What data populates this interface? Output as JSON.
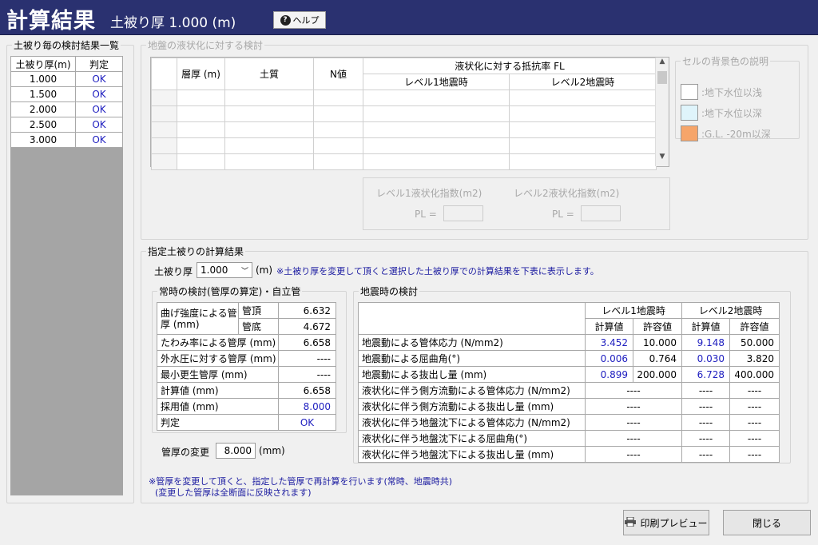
{
  "header": {
    "title": "計算結果",
    "subtitle": "土被り厚 1.000 (m)",
    "help_label": "ヘルプ"
  },
  "left_panel": {
    "legend": "土被り毎の検討結果一覧",
    "columns": [
      "土被り厚(m)",
      "判定"
    ],
    "rows": [
      {
        "depth": "1.000",
        "result": "OK"
      },
      {
        "depth": "1.500",
        "result": "OK"
      },
      {
        "depth": "2.000",
        "result": "OK"
      },
      {
        "depth": "2.500",
        "result": "OK"
      },
      {
        "depth": "3.000",
        "result": "OK"
      }
    ]
  },
  "liquefaction": {
    "legend": "地盤の液状化に対する検討",
    "col_thickness": "層厚 (m)",
    "col_soil": "土質",
    "col_n": "N値",
    "col_fl": "液状化に対する抵抗率 FL",
    "col_l1": "レベル1地震時",
    "col_l2": "レベル2地震時",
    "pl_l1_title": "レベル1液状化指数(m2)",
    "pl_l2_title": "レベル2液状化指数(m2)",
    "pl_label": "PL ="
  },
  "cell_legend": {
    "title": "セルの背景色の説明",
    "items": [
      {
        "label": ":地下水位以浅",
        "color": "#ffffff"
      },
      {
        "label": ":地下水位以深",
        "color": "#dff4fb"
      },
      {
        "label": ":G.L. -20m以深",
        "color": "#f6a56a"
      }
    ]
  },
  "spec": {
    "legend": "指定土被りの計算結果",
    "depth_label": "土被り厚",
    "depth_value": "1.000",
    "depth_unit": "(m)",
    "note": "※土被り厚を変更して頂くと選択した土被り厚での計算結果を下表に表示します。"
  },
  "normal": {
    "legend": "常時の検討(管厚の算定)・自立管",
    "bending_label": "曲げ強度による管厚 (mm)",
    "top_label": "管頂",
    "top_value": "6.632",
    "bottom_label": "管底",
    "bottom_value": "4.672",
    "rows": [
      {
        "label": "たわみ率による管厚 (mm)",
        "value": "6.658",
        "blue": false
      },
      {
        "label": "外水圧に対する管厚 (mm)",
        "value": "----",
        "blue": false
      },
      {
        "label": "最小更生管厚 (mm)",
        "value": "----",
        "blue": false
      },
      {
        "label": "計算値 (mm)",
        "value": "6.658",
        "blue": false
      },
      {
        "label": "採用値 (mm)",
        "value": "8.000",
        "blue": true
      },
      {
        "label": "判定",
        "value": "OK",
        "blue": true
      }
    ],
    "change_label": "管厚の変更",
    "change_value": "8.000",
    "change_unit": "(mm)"
  },
  "seismic": {
    "legend": "地震時の検討",
    "level1": "レベル1地震時",
    "level2": "レベル2地震時",
    "calc": "計算値",
    "allow": "許容値",
    "rows": [
      {
        "label": "地震動による管体応力 (N/mm2)",
        "c1": "3.452",
        "a1": "10.000",
        "c2": "9.148",
        "a2": "50.000"
      },
      {
        "label": "地震動による屈曲角(°)",
        "c1": "0.006",
        "a1": "0.764",
        "c2": "0.030",
        "a2": "3.820"
      },
      {
        "label": "地震動による抜出し量 (mm)",
        "c1": "0.899",
        "a1": "200.000",
        "c2": "6.728",
        "a2": "400.000"
      }
    ],
    "merged_rows": [
      {
        "label": "液状化に伴う側方流動による管体応力 (N/mm2)",
        "v1": "----",
        "c2": "----",
        "a2": "----"
      },
      {
        "label": "液状化に伴う側方流動による抜出し量 (mm)",
        "v1": "----",
        "c2": "----",
        "a2": "----"
      },
      {
        "label": "液状化に伴う地盤沈下による管体応力 (N/mm2)",
        "v1": "----",
        "c2": "----",
        "a2": "----"
      },
      {
        "label": "液状化に伴う地盤沈下による屈曲角(°)",
        "v1": "----",
        "c2": "----",
        "a2": "----"
      },
      {
        "label": "液状化に伴う地盤沈下による抜出し量 (mm)",
        "v1": "----",
        "c2": "----",
        "a2": "----"
      }
    ]
  },
  "bottom_note": {
    "line1": "※管厚を変更して頂くと、指定した管厚で再計算を行います(常時、地震時共)",
    "line2": "(変更した管厚は全断面に反映されます)"
  },
  "buttons": {
    "print_preview": "印刷プレビュー",
    "close": "閉じる"
  },
  "colors": {
    "header_bg": "#2a3170",
    "blue_value": "#2020c0"
  }
}
